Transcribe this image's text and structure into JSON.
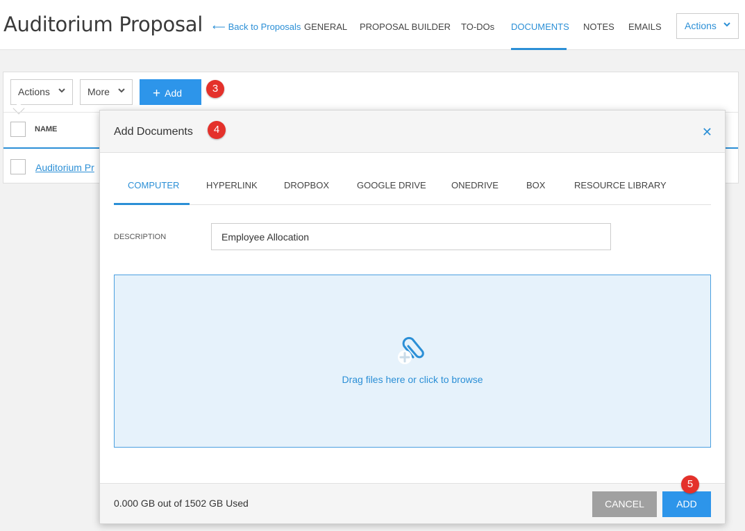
{
  "header": {
    "title": "Auditorium Proposal",
    "back_link": "Back to Proposals",
    "nav": [
      "GENERAL",
      "PROPOSAL BUILDER",
      "TO-DOs",
      "DOCUMENTS",
      "NOTES",
      "EMAILS"
    ],
    "active_nav": "DOCUMENTS",
    "actions_label": "Actions"
  },
  "toolbar": {
    "actions_label": "Actions",
    "more_label": "More",
    "add_label": "Add"
  },
  "table": {
    "column_name": "NAME",
    "rows": [
      "Auditorium Pr"
    ]
  },
  "badges": [
    "3",
    "4",
    "5"
  ],
  "modal": {
    "title": "Add Documents",
    "tabs": [
      "COMPUTER",
      "HYPERLINK",
      "DROPBOX",
      "GOOGLE DRIVE",
      "ONEDRIVE",
      "BOX",
      "RESOURCE LIBRARY"
    ],
    "active_tab": "COMPUTER",
    "description_label": "DESCRIPTION",
    "description_value": "Employee Allocation",
    "drop_text": "Drag files here or click to browse",
    "usage_text": "0.000 GB out of 1502 GB Used",
    "cancel_label": "CANCEL",
    "add_label": "ADD"
  },
  "icons": [
    "arrow-left-icon",
    "chevron-down-icon",
    "plus-icon",
    "close-icon",
    "paperclip-add-icon"
  ],
  "colors": {
    "accent": "#2b8fd6",
    "button_primary": "#2d95ea",
    "button_cancel": "#a0a0a0",
    "dropzone_bg": "#e6f2fb",
    "badge": "#e4312b"
  }
}
